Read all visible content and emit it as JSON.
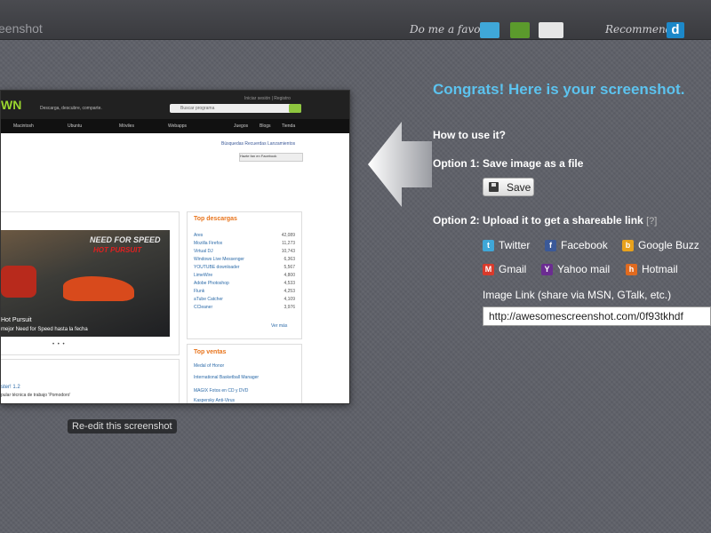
{
  "topbar": {
    "title": "eenshot",
    "favor_text": "Do me a favor",
    "recommend_text": "Recommend",
    "d_icon": "d"
  },
  "preview": {
    "logo": "WN",
    "tagline": "Descarga, descubre, comparte.",
    "header_links": "Iniciar sesión | Registro",
    "search_placeholder": "Buscar programa",
    "nav": [
      "Macintosh",
      "Ubuntu",
      "Móviles",
      "Webapps",
      "Juegos",
      "Blogs",
      "Tienda"
    ],
    "fb_text": "Búsquedas Recuerdas Lanzamientos",
    "fb_button": "Hazte fan en Facebook",
    "game_title": "NEED FOR SPEED",
    "game_subtitle": "HOT PURSUIT",
    "caption1": "Hot Pursuit",
    "caption2": "mejor Need for Speed hasta la fecha",
    "top_downloads_title": "Top descargas",
    "top_downloads": [
      {
        "name": "Ares",
        "count": "42,089"
      },
      {
        "name": "Mozilla Firefox",
        "count": "11,273"
      },
      {
        "name": "Virtual DJ",
        "count": "10,743"
      },
      {
        "name": "Windows Live Messenger",
        "count": "6,363"
      },
      {
        "name": "YOUTUBE downloader",
        "count": "5,567"
      },
      {
        "name": "LimeWire",
        "count": "4,800"
      },
      {
        "name": "Adobe Photoshop",
        "count": "4,533"
      },
      {
        "name": "Flunk",
        "count": "4,253"
      },
      {
        "name": "aTube Catcher",
        "count": "4,109"
      },
      {
        "name": "CCleaner",
        "count": "3,976"
      }
    ],
    "ver_mas": "Ver más",
    "top_sales_title": "Top ventas",
    "top_sales": [
      "Medal of Honor",
      "International Basketball Manager",
      "MAGIX Fotos en CD y DVD",
      "Kaspersky Anti-Virus"
    ],
    "left_item_title": "ster! 1.2",
    "left_item_desc": "pular técnica de trabajo 'Pomodoro'"
  },
  "reedit_label": "Re-edit this screenshot",
  "panel": {
    "congrats": "Congrats! Here is your screenshot.",
    "how": "How to use it?",
    "option1_prefix": "Option 1:",
    "option1_text": "Save image as a file",
    "save_label": "Save",
    "option2_prefix": "Option 2:",
    "option2_text": "Upload it to get a shareable link",
    "help": "[?]",
    "share": [
      {
        "label": "Twitter",
        "icon": "twitter-icon",
        "color": "#3fa7d8",
        "glyph": "t"
      },
      {
        "label": "Facebook",
        "icon": "facebook-icon",
        "color": "#3b5998",
        "glyph": "f"
      },
      {
        "label": "Google Buzz",
        "icon": "google-buzz-icon",
        "color": "#e8a21c",
        "glyph": "b"
      },
      {
        "label": "Gmail",
        "icon": "gmail-icon",
        "color": "#d93a2b",
        "glyph": "M"
      },
      {
        "label": "Yahoo mail",
        "icon": "yahoo-icon",
        "color": "#6b2c91",
        "glyph": "Y"
      },
      {
        "label": "Hotmail",
        "icon": "hotmail-icon",
        "color": "#e06a1f",
        "glyph": "h"
      }
    ],
    "image_link_label": "Image Link (share via MSN, GTalk, etc.)",
    "image_link_value": "http://awesomescreenshot.com/0f93tkhdf"
  },
  "colors": {
    "accent": "#5cc3ef",
    "background": "#5e6068"
  }
}
